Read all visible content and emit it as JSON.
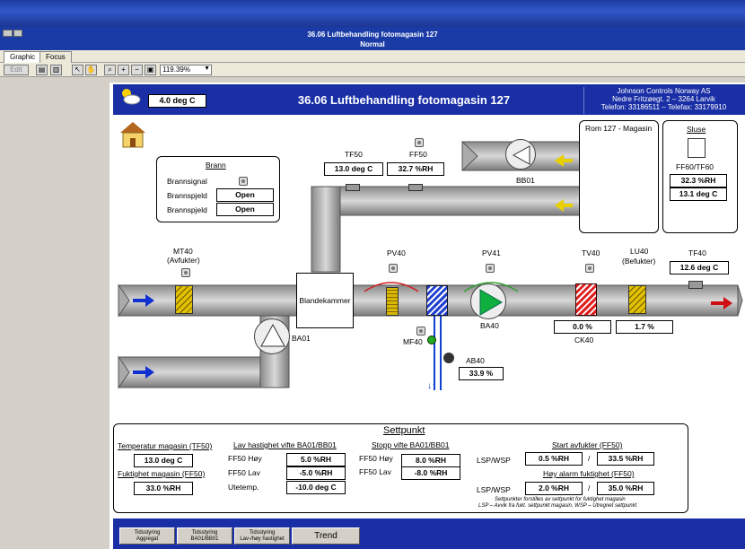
{
  "window": {
    "title": "36.06 Luftbehandling fotomagasin 127",
    "mode": "Normal"
  },
  "tabs": [
    "Graphic",
    "Focus"
  ],
  "toolbar": {
    "edit_label": "Edit",
    "zoom": "119.39%"
  },
  "header": {
    "title": "36.06 Luftbehandling fotomagasin 127",
    "outdoor_temp": "4.0 deg C",
    "company": [
      "Johnson Controls Norway AS",
      "Nedre Fritzøegt. 2 – 3264 Larvik",
      "Telefon: 33186511 – Telefax: 33179910"
    ]
  },
  "brann": {
    "title": "Brann",
    "rows": [
      {
        "label": "Brannsignal"
      },
      {
        "label": "Brannspjeld",
        "value": "Open"
      },
      {
        "label": "Brannspjeld",
        "value": "Open"
      }
    ]
  },
  "sensors": {
    "tf50": {
      "label": "TF50",
      "value": "13.0 deg C"
    },
    "ff50": {
      "label": "FF50",
      "value": "32.7 %RH"
    },
    "bb01": {
      "label": "BB01"
    },
    "mt40": {
      "label": "MT40",
      "sub": "(Avfukter)"
    },
    "pv40": {
      "label": "PV40"
    },
    "pv41": {
      "label": "PV41"
    },
    "tv40": {
      "label": "TV40"
    },
    "lu40": {
      "label": "LU40",
      "sub": "(Befukter)"
    },
    "tf40": {
      "label": "TF40",
      "value": "12.6 deg C"
    },
    "blandekammer": "Blandekammer",
    "ba01": "BA01",
    "ba40": "BA40",
    "mf40": "MF40",
    "ab40": {
      "label": "AB40",
      "value": "33.9 %"
    },
    "ck40": {
      "label": "CK40",
      "value": "0.0 %"
    },
    "lu40_value": "1.7 %"
  },
  "rom": {
    "label": "Rom 127 - Magasin"
  },
  "sluse": {
    "label": "Sluse",
    "sub": "FF60/TF60",
    "rh": "32.3 %RH",
    "temp": "13.1 deg C"
  },
  "settpunkt": {
    "title": "Settpunkt",
    "temp_label": "Temperatur magasin (TF50)",
    "temp": "13.0 deg C",
    "fukt_label": "Fuktighet magasin (FF50)",
    "fukt": "33.0 %RH",
    "lav_title": "Lav hastighet vifte BA01/BB01",
    "lav": [
      {
        "label": "FF50 Høy",
        "value": "5.0 %RH"
      },
      {
        "label": "FF50 Lav",
        "value": "-5.0 %RH"
      },
      {
        "label": "Utetemp.",
        "value": "-10.0 deg C"
      }
    ],
    "stopp_title": "Stopp vifte BA01/BB01",
    "stopp": [
      {
        "label": "FF50 Høy",
        "value": "8.0 %RH"
      },
      {
        "label": "FF50 Lav",
        "value": "-8.0 %RH"
      }
    ],
    "start_title": "Start avfukter (FF50)",
    "start": {
      "label": "LSP/WSP",
      "lsp": "0.5 %RH",
      "sep": "/",
      "wsp": "33.5 %RH"
    },
    "alarm_title": "Høy alarm fuktighet (FF50)",
    "alarm": {
      "label": "LSP/WSP",
      "lsp": "2.0 %RH",
      "sep": "/",
      "wsp": "35.0 %RH"
    },
    "note1": "Settpunkter forstilles av settpunkt for fuktighet magasin",
    "note2": "LSP – Avvik fra fukt. settpunkt magasin, WSP – Utregnet settpunkt"
  },
  "bottom_buttons": [
    {
      "line1": "Tidsstyring",
      "line2": "Aggregat"
    },
    {
      "line1": "Tidsstyring",
      "line2": "BA01/BB01"
    },
    {
      "line1": "Tidsstyring",
      "line2": "Lav-/høy hastighet"
    }
  ],
  "trend_label": "Trend"
}
